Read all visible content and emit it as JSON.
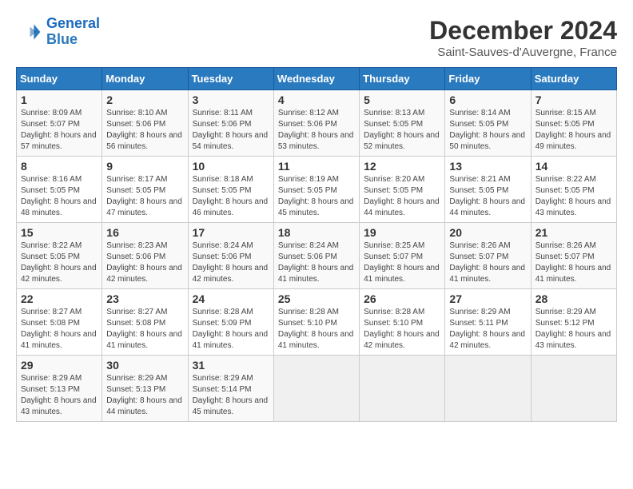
{
  "logo": {
    "line1": "General",
    "line2": "Blue"
  },
  "title": "December 2024",
  "location": "Saint-Sauves-d'Auvergne, France",
  "weekdays": [
    "Sunday",
    "Monday",
    "Tuesday",
    "Wednesday",
    "Thursday",
    "Friday",
    "Saturday"
  ],
  "weeks": [
    [
      {
        "day": "1",
        "sunrise": "8:09 AM",
        "sunset": "5:07 PM",
        "daylight": "8 hours and 57 minutes."
      },
      {
        "day": "2",
        "sunrise": "8:10 AM",
        "sunset": "5:06 PM",
        "daylight": "8 hours and 56 minutes."
      },
      {
        "day": "3",
        "sunrise": "8:11 AM",
        "sunset": "5:06 PM",
        "daylight": "8 hours and 54 minutes."
      },
      {
        "day": "4",
        "sunrise": "8:12 AM",
        "sunset": "5:06 PM",
        "daylight": "8 hours and 53 minutes."
      },
      {
        "day": "5",
        "sunrise": "8:13 AM",
        "sunset": "5:05 PM",
        "daylight": "8 hours and 52 minutes."
      },
      {
        "day": "6",
        "sunrise": "8:14 AM",
        "sunset": "5:05 PM",
        "daylight": "8 hours and 50 minutes."
      },
      {
        "day": "7",
        "sunrise": "8:15 AM",
        "sunset": "5:05 PM",
        "daylight": "8 hours and 49 minutes."
      }
    ],
    [
      {
        "day": "8",
        "sunrise": "8:16 AM",
        "sunset": "5:05 PM",
        "daylight": "8 hours and 48 minutes."
      },
      {
        "day": "9",
        "sunrise": "8:17 AM",
        "sunset": "5:05 PM",
        "daylight": "8 hours and 47 minutes."
      },
      {
        "day": "10",
        "sunrise": "8:18 AM",
        "sunset": "5:05 PM",
        "daylight": "8 hours and 46 minutes."
      },
      {
        "day": "11",
        "sunrise": "8:19 AM",
        "sunset": "5:05 PM",
        "daylight": "8 hours and 45 minutes."
      },
      {
        "day": "12",
        "sunrise": "8:20 AM",
        "sunset": "5:05 PM",
        "daylight": "8 hours and 44 minutes."
      },
      {
        "day": "13",
        "sunrise": "8:21 AM",
        "sunset": "5:05 PM",
        "daylight": "8 hours and 44 minutes."
      },
      {
        "day": "14",
        "sunrise": "8:22 AM",
        "sunset": "5:05 PM",
        "daylight": "8 hours and 43 minutes."
      }
    ],
    [
      {
        "day": "15",
        "sunrise": "8:22 AM",
        "sunset": "5:05 PM",
        "daylight": "8 hours and 42 minutes."
      },
      {
        "day": "16",
        "sunrise": "8:23 AM",
        "sunset": "5:06 PM",
        "daylight": "8 hours and 42 minutes."
      },
      {
        "day": "17",
        "sunrise": "8:24 AM",
        "sunset": "5:06 PM",
        "daylight": "8 hours and 42 minutes."
      },
      {
        "day": "18",
        "sunrise": "8:24 AM",
        "sunset": "5:06 PM",
        "daylight": "8 hours and 41 minutes."
      },
      {
        "day": "19",
        "sunrise": "8:25 AM",
        "sunset": "5:07 PM",
        "daylight": "8 hours and 41 minutes."
      },
      {
        "day": "20",
        "sunrise": "8:26 AM",
        "sunset": "5:07 PM",
        "daylight": "8 hours and 41 minutes."
      },
      {
        "day": "21",
        "sunrise": "8:26 AM",
        "sunset": "5:07 PM",
        "daylight": "8 hours and 41 minutes."
      }
    ],
    [
      {
        "day": "22",
        "sunrise": "8:27 AM",
        "sunset": "5:08 PM",
        "daylight": "8 hours and 41 minutes."
      },
      {
        "day": "23",
        "sunrise": "8:27 AM",
        "sunset": "5:08 PM",
        "daylight": "8 hours and 41 minutes."
      },
      {
        "day": "24",
        "sunrise": "8:28 AM",
        "sunset": "5:09 PM",
        "daylight": "8 hours and 41 minutes."
      },
      {
        "day": "25",
        "sunrise": "8:28 AM",
        "sunset": "5:10 PM",
        "daylight": "8 hours and 41 minutes."
      },
      {
        "day": "26",
        "sunrise": "8:28 AM",
        "sunset": "5:10 PM",
        "daylight": "8 hours and 42 minutes."
      },
      {
        "day": "27",
        "sunrise": "8:29 AM",
        "sunset": "5:11 PM",
        "daylight": "8 hours and 42 minutes."
      },
      {
        "day": "28",
        "sunrise": "8:29 AM",
        "sunset": "5:12 PM",
        "daylight": "8 hours and 43 minutes."
      }
    ],
    [
      {
        "day": "29",
        "sunrise": "8:29 AM",
        "sunset": "5:13 PM",
        "daylight": "8 hours and 43 minutes."
      },
      {
        "day": "30",
        "sunrise": "8:29 AM",
        "sunset": "5:13 PM",
        "daylight": "8 hours and 44 minutes."
      },
      {
        "day": "31",
        "sunrise": "8:29 AM",
        "sunset": "5:14 PM",
        "daylight": "8 hours and 45 minutes."
      },
      null,
      null,
      null,
      null
    ]
  ]
}
